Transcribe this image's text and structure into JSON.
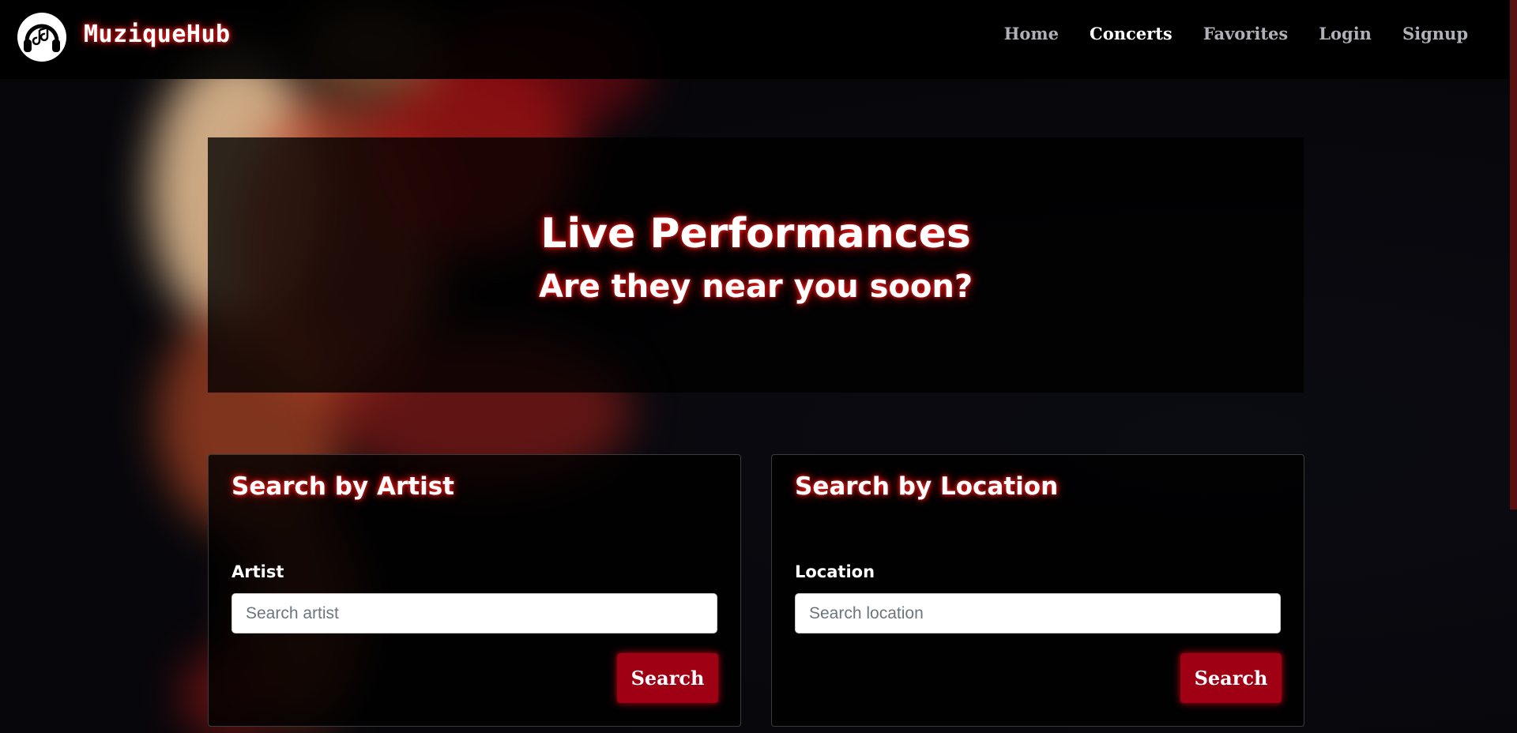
{
  "brand": {
    "name": "MuziqueHub",
    "logo_icon": "headphones-music-icon",
    "accent": "#ff2a2a"
  },
  "nav": {
    "items": [
      {
        "label": "Home",
        "active": false
      },
      {
        "label": "Concerts",
        "active": true
      },
      {
        "label": "Favorites",
        "active": false
      },
      {
        "label": "Login",
        "active": false
      },
      {
        "label": "Signup",
        "active": false
      }
    ]
  },
  "hero": {
    "title": "Live Performances",
    "subtitle": "Are they near you soon?"
  },
  "artist_search": {
    "title": "Search by Artist",
    "label": "Artist",
    "placeholder": "Search artist",
    "value": "",
    "button": "Search"
  },
  "location_search": {
    "title": "Search by Location",
    "label": "Location",
    "placeholder": "Search location",
    "value": "",
    "button": "Search"
  },
  "colors": {
    "button_bg": "#a00014",
    "glow": "#ff2a2a",
    "background": "#07070b"
  }
}
